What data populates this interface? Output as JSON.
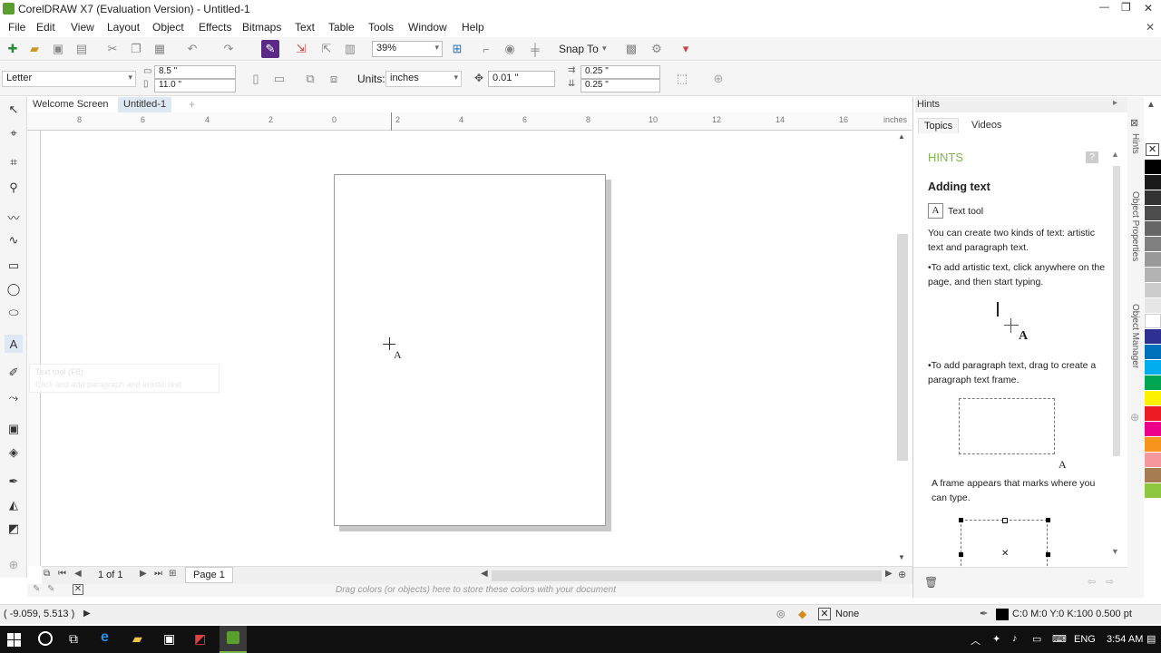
{
  "window": {
    "title": "CorelDRAW X7 (Evaluation Version) - Untitled-1",
    "min": "—",
    "max": "❐",
    "close": "✕"
  },
  "menu": [
    "File",
    "Edit",
    "View",
    "Layout",
    "Object",
    "Effects",
    "Bitmaps",
    "Text",
    "Table",
    "Tools",
    "Window",
    "Help"
  ],
  "toolbar": {
    "zoom": "39%",
    "snap_to": "Snap To"
  },
  "propbar": {
    "paper": "Letter",
    "width": "8.5 \"",
    "height": "11.0 \"",
    "units_label": "Units:",
    "units": "inches",
    "nudge": "0.01 \"",
    "dup_x": "0.25 \"",
    "dup_y": "0.25 \""
  },
  "tabs": {
    "welcome": "Welcome Screen",
    "doc": "Untitled-1"
  },
  "ruler": {
    "h_labels": [
      "8",
      "6",
      "4",
      "2",
      "0",
      "2",
      "4",
      "6",
      "8",
      "10",
      "12",
      "14",
      "16"
    ],
    "unit": "inches"
  },
  "tooltip": {
    "title": "Text tool (F8)",
    "body": "Click and add paragraph and artistic text"
  },
  "nav": {
    "page_count": "1 of 1",
    "page_tab": "Page 1"
  },
  "palette_hint": "Drag colors (or objects) here to store these colors with your document",
  "status": {
    "coords": "( -9.059, 5.513 )",
    "fill": "None",
    "outline": "C:0 M:0 Y:0 K:100  0.500 pt"
  },
  "hints": {
    "panel_title": "Hints",
    "tab_topics": "Topics",
    "tab_videos": "Videos",
    "heading": "HINTS",
    "topic": "Adding text",
    "tool_name": "Text tool",
    "intro": "You can create two kinds of text: artistic text and paragraph text.",
    "bullet1": "•To add artistic text, click anywhere on the page, and then start typing.",
    "bullet2": "•To add paragraph text, drag to create a paragraph text frame.",
    "frame_note": "A frame appears that marks where you can type.",
    "accent": "#7ab648"
  },
  "dock": {
    "hints_label": "Hints",
    "obj_props": "Object Properties",
    "obj_mgr": "Object Manager"
  },
  "palette_colors": [
    "#000000",
    "#1a1a1a",
    "#333333",
    "#4d4d4d",
    "#666666",
    "#808080",
    "#999999",
    "#b3b3b3",
    "#cccccc",
    "#e6e6e6",
    "#ffffff",
    "#2e3192",
    "#0072bc",
    "#00aeef",
    "#00a651",
    "#fff200",
    "#ed1c24",
    "#ec008c",
    "#f7941d",
    "#f5989d",
    "#a67c52",
    "#8dc63f"
  ],
  "taskbar": {
    "lang": "ENG",
    "time": "3:54 AM"
  }
}
